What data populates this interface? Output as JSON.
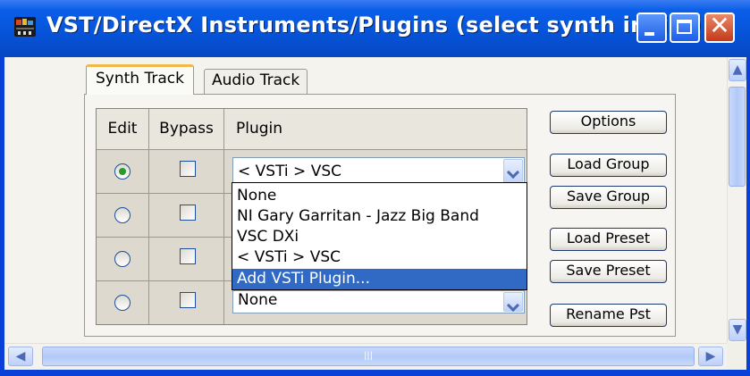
{
  "window": {
    "title": "VST/DirectX Instruments/Plugins (select synth in list)",
    "colors": {
      "titlebar": "#0653d8",
      "selection": "#316ac5",
      "tab_highlight": "#f2b94a"
    }
  },
  "tabs": [
    {
      "label": "Synth Track",
      "active": true
    },
    {
      "label": "Audio Track",
      "active": false
    }
  ],
  "table": {
    "headers": {
      "edit": "Edit",
      "bypass": "Bypass",
      "plugin": "Plugin"
    },
    "rows": [
      {
        "edit_selected": true,
        "bypass": false,
        "plugin": "< VSTi > VSC"
      },
      {
        "edit_selected": false,
        "bypass": false,
        "plugin": ""
      },
      {
        "edit_selected": false,
        "bypass": false,
        "plugin": ""
      },
      {
        "edit_selected": false,
        "bypass": false,
        "plugin": "None"
      }
    ]
  },
  "dropdown": {
    "options": [
      "None",
      "NI Gary Garritan - Jazz Big Band",
      "VSC DXi",
      "< VSTi > VSC",
      "Add VSTi Plugin..."
    ],
    "highlighted": "Add VSTi Plugin..."
  },
  "buttons": {
    "options": "Options",
    "load_group": "Load Group",
    "save_group": "Save Group",
    "load_preset": "Load Preset",
    "save_preset": "Save Preset",
    "rename_pst": "Rename Pst"
  },
  "scrollbars": {
    "vertical": "vertical-scrollbar",
    "horizontal": "horizontal-scrollbar"
  }
}
